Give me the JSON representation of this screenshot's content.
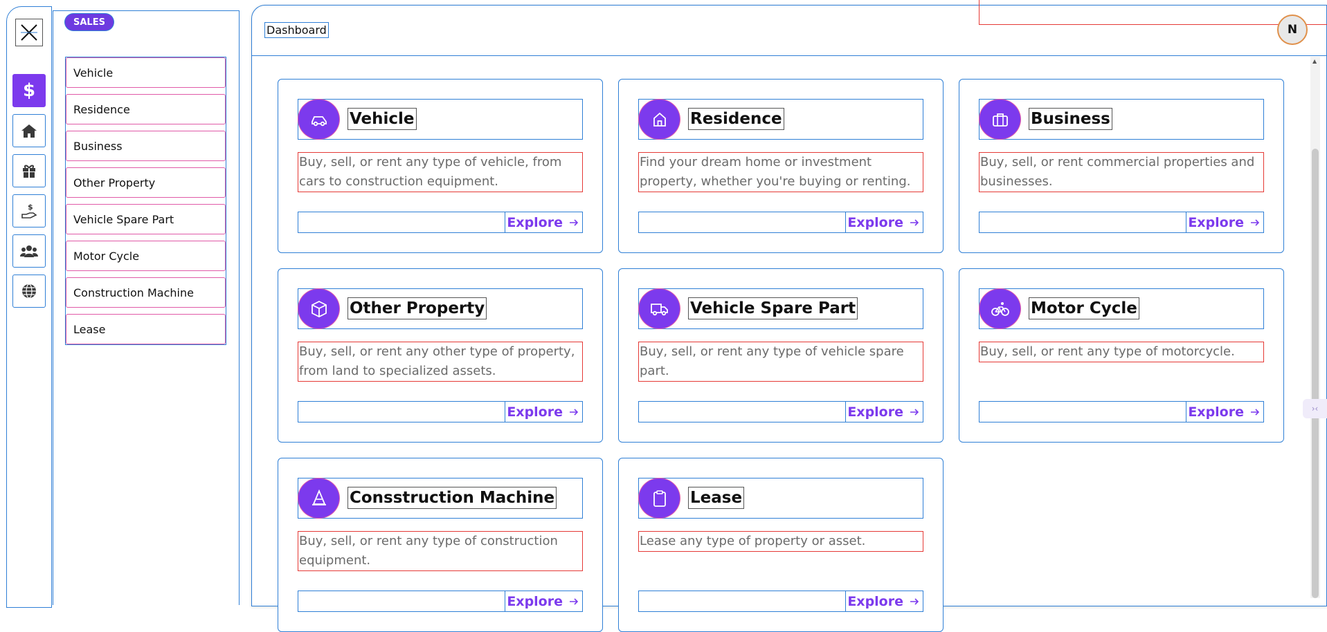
{
  "sidebar": {
    "section_badge": "SALES",
    "close_icon": "close-icon",
    "rail_icons": [
      "dollar-icon",
      "home-icon",
      "gift-icon",
      "hand-coin-icon",
      "users-icon",
      "globe-icon"
    ],
    "submenu": [
      "Vehicle",
      "Residence",
      "Business",
      "Other Property",
      "Vehicle Spare Part",
      "Motor Cycle",
      "Construction Machine",
      "Lease"
    ]
  },
  "header": {
    "breadcrumb": "Dashboard",
    "avatar_initial": "N"
  },
  "cards": [
    {
      "title": "Vehicle",
      "desc": "Buy, sell, or rent any type of vehicle, from cars to construction equipment.",
      "cta": "Explore",
      "icon": "car-icon"
    },
    {
      "title": "Residence",
      "desc": "Find your dream home or investment property, whether you're buying or renting.",
      "cta": "Explore",
      "icon": "house-icon"
    },
    {
      "title": "Business",
      "desc": "Buy, sell, or rent commercial properties and businesses.",
      "cta": "Explore",
      "icon": "briefcase-icon"
    },
    {
      "title": "Other Property",
      "desc": "Buy, sell, or rent any other type of property, from land to specialized assets.",
      "cta": "Explore",
      "icon": "box-icon"
    },
    {
      "title": "Vehicle Spare Part",
      "desc": "Buy, sell, or rent any type of vehicle spare part.",
      "cta": "Explore",
      "icon": "truck-icon"
    },
    {
      "title": "Motor Cycle",
      "desc": "Buy, sell, or rent any type of motorcycle.",
      "cta": "Explore",
      "icon": "bike-icon"
    },
    {
      "title": "Consstruction Machine",
      "desc": "Buy, sell, or rent any type of construction equipment.",
      "cta": "Explore",
      "icon": "cone-icon"
    },
    {
      "title": "Lease",
      "desc": "Lease any type of property or asset.",
      "cta": "Explore",
      "icon": "clipboard-icon"
    }
  ],
  "colors": {
    "accent": "#7c3aed",
    "outline": "#2f7fd6",
    "desc_outline": "#e53935"
  }
}
